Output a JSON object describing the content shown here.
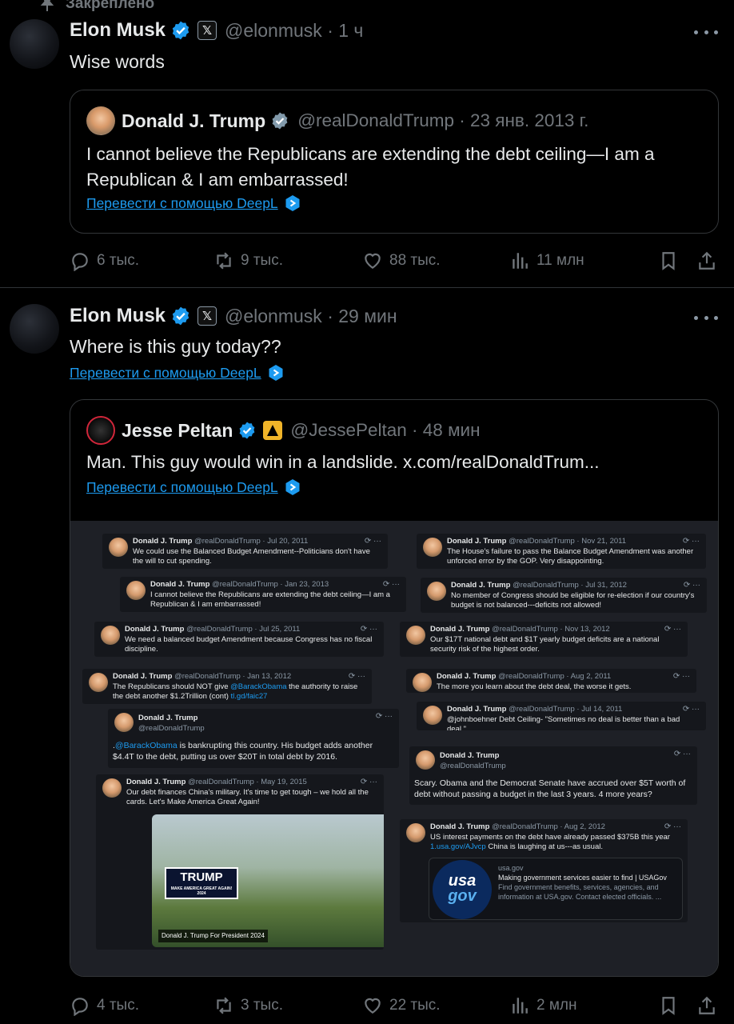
{
  "pinned_label": "Закреплено",
  "posts": [
    {
      "author": "Elon Musk",
      "handle_time": "@elonmusk · 1 ч",
      "text": "Wise words",
      "quote": {
        "author": "Donald J. Trump",
        "handle_time": "@realDonaldTrump · 23 янв. 2013 г.",
        "text": "I cannot believe the Republicans are extending the debt ceiling—I am a Republican & I am embarrassed!",
        "translate": "Перевести с помощью DeepL"
      },
      "actions": {
        "replies": "6 тыс.",
        "reposts": "9 тыс.",
        "likes": "88 тыс.",
        "views": "11 млн"
      }
    },
    {
      "author": "Elon Musk",
      "handle_time": "@elonmusk · 29 мин",
      "text": "Where is this guy today??",
      "translate": "Перевести с помощью DeepL",
      "quote": {
        "author": "Jesse Peltan",
        "handle_time": "@JessePeltan · 48 мин",
        "text": "Man. This guy would win in a landslide.  x.com/realDonaldTrum...",
        "translate": "Перевести с помощью DeepL"
      },
      "actions": {
        "replies": "4 тыс.",
        "reposts": "3 тыс.",
        "likes": "22 тыс.",
        "views": "2 млн"
      }
    }
  ],
  "collage": {
    "t1": {
      "head": "Donald J. Trump",
      "meta": "@realDonaldTrump · Jul 20, 2011",
      "body": "We could use the Balanced Budget Amendment--Politicians don't have the will to cut spending."
    },
    "t2": {
      "head": "Donald J. Trump",
      "meta": "@realDonaldTrump · Jan 23, 2013",
      "body": "I cannot believe the Republicans are extending the debt ceiling—I am a Republican & I am embarrassed!"
    },
    "t3": {
      "head": "Donald J. Trump",
      "meta": "@realDonaldTrump · Jul 25, 2011",
      "body": "We need a balanced budget Amendment because Congress has no fiscal discipline."
    },
    "t4": {
      "head": "Donald J. Trump",
      "meta": "@realDonaldTrump · Jan 13, 2012",
      "body_a": "The Republicans should NOT give ",
      "link_a": "@BarackObama",
      "body_b": " the authority to raise the debt another $1.2Trillion (cont) ",
      "link_b": "tl.gd/faic27"
    },
    "t5": {
      "head": "Donald J. Trump",
      "meta": "@realDonaldTrump",
      "prefix": ".",
      "link": "@BarackObama",
      "body": " is bankrupting this country. His budget adds another $4.4T to the debt, putting us over $20T in total debt by 2016."
    },
    "t6": {
      "head": "Donald J. Trump",
      "meta": "@realDonaldTrump · May 19, 2015",
      "body": "Our debt finances China's military. It's time to get tough – we hold all the cards. Let's Make America Great Again!",
      "sign": "TRUMP",
      "sign_sub": "MAKE AMERICA GREAT AGAIN! 2024",
      "caption": "Donald J. Trump For President 2024"
    },
    "t7": {
      "head": "Donald J. Trump",
      "meta": "@realDonaldTrump · Nov 21, 2011",
      "body": "The House's failure to pass the Balance Budget Amendment was another unforced error by the GOP. Very disappointing."
    },
    "t8": {
      "head": "Donald J. Trump",
      "meta": "@realDonaldTrump · Jul 31, 2012",
      "body": "No member of Congress should be eligible for re-election if our country's budget is not balanced---deficits not allowed!"
    },
    "t9": {
      "head": "Donald J. Trump",
      "meta": "@realDonaldTrump · Nov 13, 2012",
      "body": "Our $17T national debt and $1T yearly budget deficits are a national security risk of the highest order."
    },
    "t10": {
      "head": "Donald J. Trump",
      "meta": "@realDonaldTrump · Aug 2, 2011",
      "body": "The more you learn about the debt deal, the worse it gets."
    },
    "t11": {
      "head": "Donald J. Trump",
      "meta": "@realDonaldTrump · Jul 14, 2011",
      "body": "@johnboehner Debt Ceiling- \"Sometimes no deal is better than a bad deal.\""
    },
    "t12": {
      "head": "Donald J. Trump",
      "meta": "@realDonaldTrump",
      "body": "Scary.  Obama and the Democrat Senate have accrued over $5T worth of debt without passing a budget in the last 3 years.  4 more years?"
    },
    "t13": {
      "head": "Donald J. Trump",
      "meta": "@realDonaldTrump · Aug 2, 2012",
      "body": "US interest payments on the debt have already passed $375B this year ",
      "link": "1.usa.gov/AJvcp",
      "body2": " China is laughing at us---as usual.",
      "card_domain": "usa.gov",
      "card_title": "Making government services easier to find | USAGov",
      "card_desc": "Find government benefits, services, agencies, and information at USA.gov. Contact elected officials. ...",
      "logo_top": "usa",
      "logo_bottom": "gov"
    }
  }
}
